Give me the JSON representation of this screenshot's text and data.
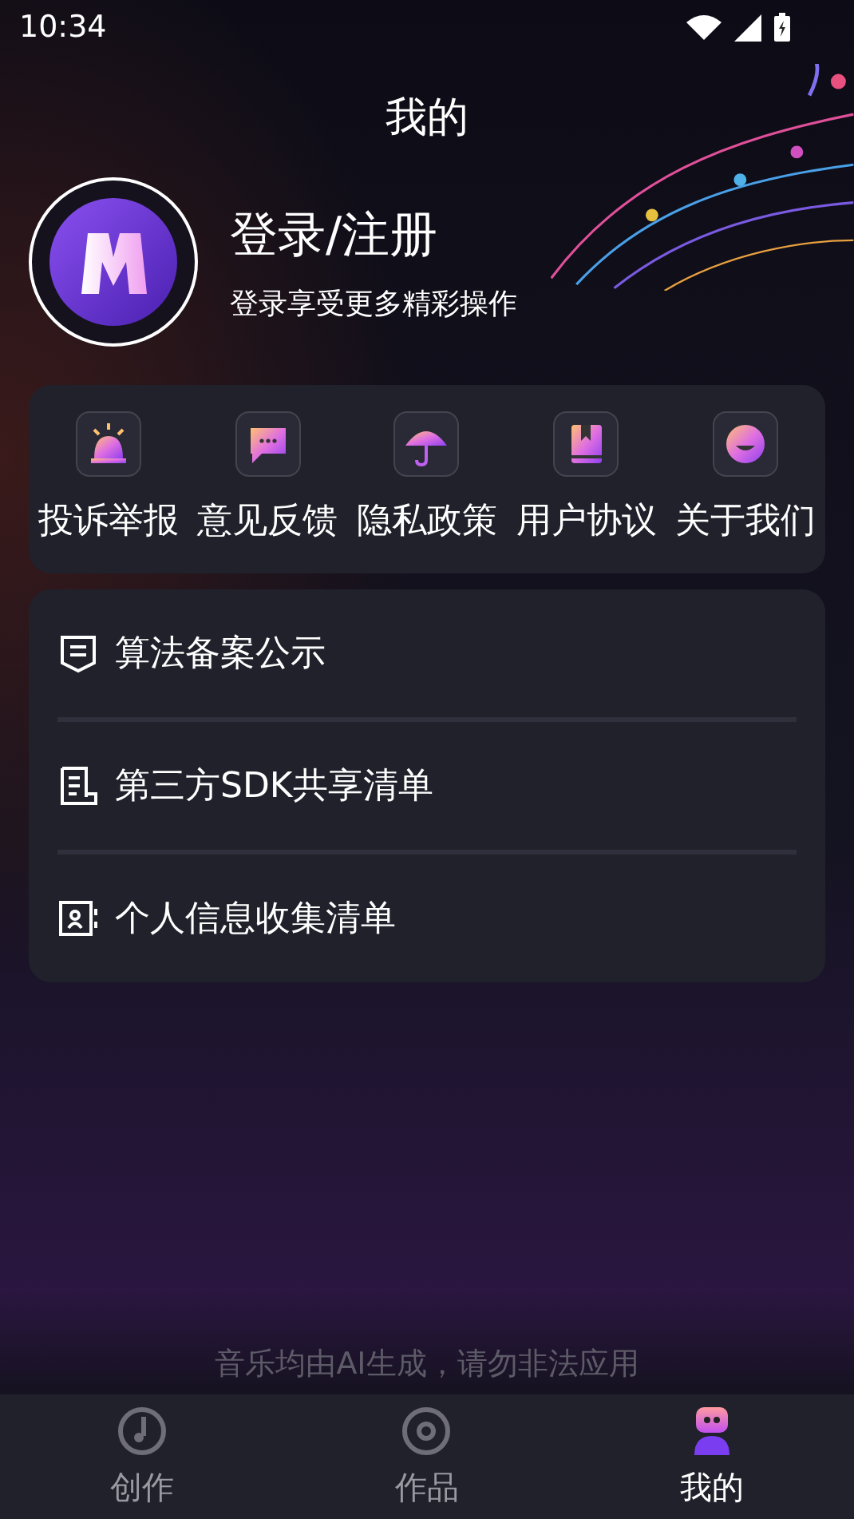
{
  "status_bar": {
    "time": "10:34"
  },
  "header": {
    "title": "我的"
  },
  "profile": {
    "name": "登录/注册",
    "subtitle": "登录享受更多精彩操作"
  },
  "shortcuts": [
    {
      "label": "投诉举报",
      "kind": "alarm"
    },
    {
      "label": "意见反馈",
      "kind": "chat"
    },
    {
      "label": "隐私政策",
      "kind": "umbrella"
    },
    {
      "label": "用户协议",
      "kind": "book"
    },
    {
      "label": "关于我们",
      "kind": "smile"
    }
  ],
  "menu": [
    {
      "label": "算法备案公示",
      "kind": "shield"
    },
    {
      "label": "第三方SDK共享清单",
      "kind": "document"
    },
    {
      "label": "个人信息收集清单",
      "kind": "contact"
    }
  ],
  "footer_note": "音乐均由AI生成，请勿非法应用",
  "tabs": [
    {
      "label": "创作",
      "kind": "note",
      "selected": false
    },
    {
      "label": "作品",
      "kind": "disc",
      "selected": false
    },
    {
      "label": "我的",
      "kind": "robot",
      "selected": true
    }
  ]
}
